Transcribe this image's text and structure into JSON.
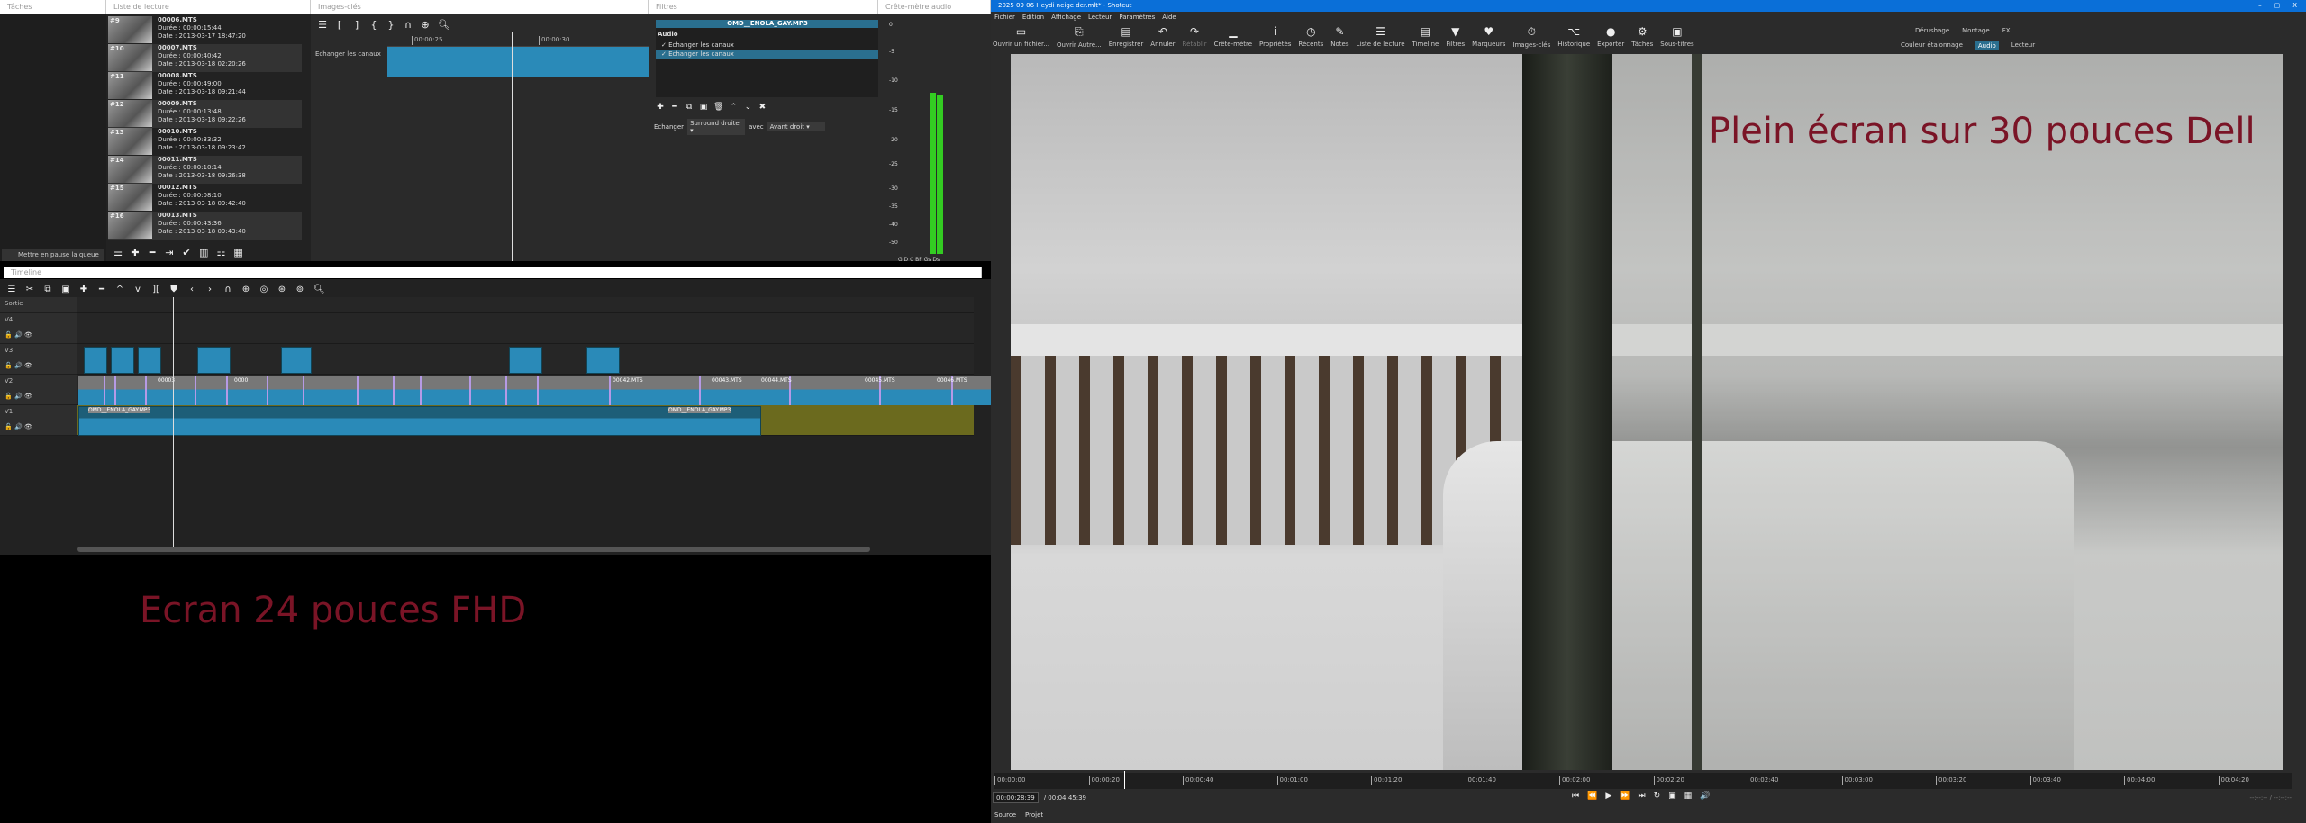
{
  "left": {
    "tasks": {
      "title": "Tâches",
      "pause_label": "Mettre en pause la queue"
    },
    "playlist": {
      "title": "Liste de lecture",
      "items": [
        {
          "num": "#9",
          "name": "00006.MTS",
          "duration": "Durée : 00:00:15:44",
          "date": "Date : 2013-03-17 18:47:20"
        },
        {
          "num": "#10",
          "name": "00007.MTS",
          "duration": "Durée : 00:00:40:42",
          "date": "Date : 2013-03-18 02:20:26"
        },
        {
          "num": "#11",
          "name": "00008.MTS",
          "duration": "Durée : 00:00:49:00",
          "date": "Date : 2013-03-18 09:21:44"
        },
        {
          "num": "#12",
          "name": "00009.MTS",
          "duration": "Durée : 00:00:13:48",
          "date": "Date : 2013-03-18 09:22:26"
        },
        {
          "num": "#13",
          "name": "00010.MTS",
          "duration": "Durée : 00:00:33:32",
          "date": "Date : 2013-03-18 09:23:42"
        },
        {
          "num": "#14",
          "name": "00011.MTS",
          "duration": "Durée : 00:00:10:14",
          "date": "Date : 2013-03-18 09:26:38"
        },
        {
          "num": "#15",
          "name": "00012.MTS",
          "duration": "Durée : 00:00:08:10",
          "date": "Date : 2013-03-18 09:42:40"
        },
        {
          "num": "#16",
          "name": "00013.MTS",
          "duration": "Durée : 00:00:43:36",
          "date": "Date : 2013-03-18 09:43:40"
        }
      ],
      "toolbar": [
        "☰",
        "✚",
        "━",
        "⇥",
        "✔",
        "▥",
        "☷",
        "▦"
      ]
    },
    "keyframes": {
      "title": "Images-clés",
      "toolbar": [
        "☰",
        "[",
        "]",
        "{",
        "}",
        "∩",
        "⊕",
        "🔍︎"
      ],
      "ruler": [
        "00:00:25",
        "00:00:30"
      ],
      "filter_label": "Echanger les canaux"
    },
    "filters": {
      "title": "Filtres",
      "clip_name": "OMD__ENOLA_GAY.MP3",
      "category": "Audio",
      "items": [
        "Echanger les canaux",
        "Echanger les canaux"
      ],
      "toolbar": [
        "✚",
        "━",
        "⧉",
        "▣",
        "🗑",
        "⌃",
        "⌄",
        "✖"
      ],
      "swap_label": "Echanger",
      "swap_value": "Surround droite",
      "with_label": "avec",
      "with_value": "Avant droit"
    },
    "meter": {
      "title": "Crête-mètre audio",
      "scale": [
        "0",
        "-5",
        "-10",
        "-15",
        "-20",
        "-25",
        "-30",
        "-35",
        "-40",
        "-50"
      ],
      "channels": "G D C BF Gs Ds",
      "levels": [
        0.83,
        0.82
      ],
      "color": "#33cc22"
    },
    "timeline": {
      "title": "Timeline",
      "toolbar": [
        "☰",
        "✂",
        "⧉",
        "▣",
        "✚",
        "━",
        "^",
        "v",
        "][",
        "⛊",
        "‹",
        "›",
        "∩",
        "⊕",
        "◎",
        "⊛",
        "⊚",
        "🔍︎"
      ],
      "tracks": [
        {
          "name": "Sortie"
        },
        {
          "name": "V4"
        },
        {
          "name": "V3"
        },
        {
          "name": "V2"
        },
        {
          "name": "V1"
        }
      ],
      "audio_clip_labels": [
        "OMD__ENOLA_GAY.MP3",
        "OMD__ENOLA_GAY.MP3"
      ],
      "v2_clip_labels": [
        "00003",
        "0000",
        "00042.MTS",
        "00043.MTS",
        "00044.MTS",
        "00045.MTS",
        "00046.MTS"
      ]
    },
    "annotation": "Ecran 24 pouces FHD"
  },
  "right": {
    "window_title": "2025 09 06 Heydi neige der.mlt* - Shotcut",
    "window_controls": [
      "–",
      "▢",
      "X"
    ],
    "menu": [
      "Fichier",
      "Edition",
      "Affichage",
      "Lecteur",
      "Paramètres",
      "Aide"
    ],
    "toolbar": [
      {
        "icon": "folder-icon",
        "glyph": "▭",
        "label": "Ouvrir un fichier..."
      },
      {
        "icon": "open-other-icon",
        "glyph": "⎘",
        "label": "Ouvrir Autre..."
      },
      {
        "icon": "save-icon",
        "glyph": "▤",
        "label": "Enregistrer"
      },
      {
        "icon": "undo-icon",
        "glyph": "↶",
        "label": "Annuler"
      },
      {
        "icon": "redo-icon",
        "glyph": "↷",
        "label": "Rétablir"
      },
      {
        "icon": "peak-meter-icon",
        "glyph": "▁",
        "label": "Crête-mètre"
      },
      {
        "icon": "info-icon",
        "glyph": "i",
        "label": "Propriétés"
      },
      {
        "icon": "clock-icon",
        "glyph": "◷",
        "label": "Récents"
      },
      {
        "icon": "notes-icon",
        "glyph": "✎",
        "label": "Notes"
      },
      {
        "icon": "list-icon",
        "glyph": "☰",
        "label": "Liste de lecture"
      },
      {
        "icon": "timeline-icon",
        "glyph": "▤",
        "label": "Timeline"
      },
      {
        "icon": "filter-icon",
        "glyph": "▼",
        "label": "Filtres"
      },
      {
        "icon": "marker-icon",
        "glyph": "♥",
        "label": "Marqueurs"
      },
      {
        "icon": "stopwatch-icon",
        "glyph": "⏱",
        "label": "Images-clés"
      },
      {
        "icon": "history-icon",
        "glyph": "⌥",
        "label": "Historique"
      },
      {
        "icon": "export-icon",
        "glyph": "●",
        "label": "Exporter"
      },
      {
        "icon": "gear-icon",
        "glyph": "⚙",
        "label": "Tâches"
      },
      {
        "icon": "subtitles-icon",
        "glyph": "▣",
        "label": "Sous-titres"
      }
    ],
    "layouts_top": [
      "Dérushage",
      "Montage",
      "FX"
    ],
    "layouts_bottom": [
      "Couleur étalonnage",
      "Audio",
      "Lecteur"
    ],
    "active_layout": "Audio",
    "annotation": "Plein écran sur 30 pouces Dell",
    "ruler": [
      "00:00:00",
      "00:00:20",
      "00:00:40",
      "00:01:00",
      "00:01:20",
      "00:01:40",
      "00:02:00",
      "00:02:20",
      "00:02:40",
      "00:03:00",
      "00:03:20",
      "00:03:40",
      "00:04:00",
      "00:04:20"
    ],
    "position": "00:00:28:39",
    "duration": "/ 00:04:45:39",
    "transport": [
      "⏮",
      "⏪",
      "▶",
      "⏩",
      "⏭",
      "↻",
      "▣",
      "▦",
      "🔊"
    ],
    "in_out": "--:--:-- / --:--:--",
    "tabs": [
      "Source",
      "Projet"
    ]
  }
}
